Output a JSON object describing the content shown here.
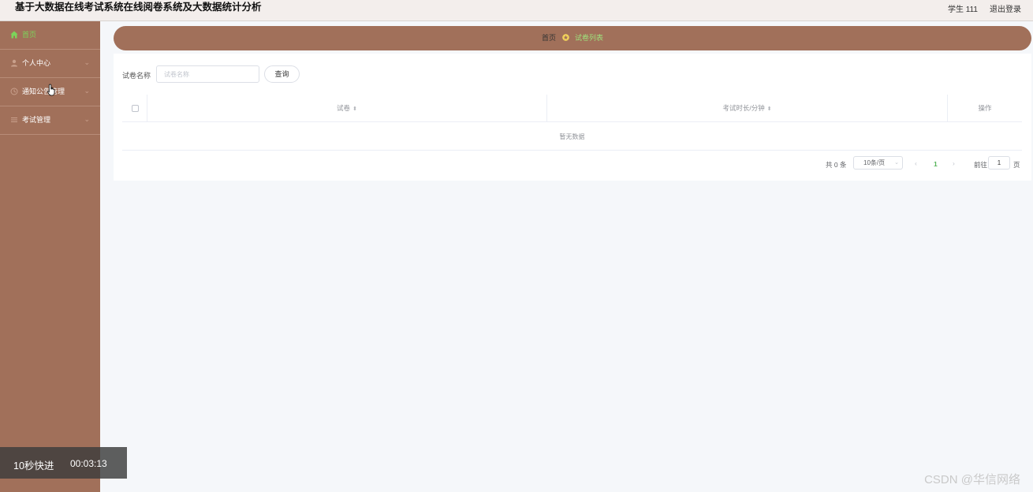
{
  "header": {
    "title": "基于大数据在线考试系统在线阅卷系统及大数据统计分析",
    "user": "学生 111",
    "logout": "退出登录"
  },
  "sidebar": {
    "items": [
      {
        "label": "首页",
        "icon": "home-icon",
        "active": true
      },
      {
        "label": "个人中心",
        "icon": "user-icon",
        "expandable": true
      },
      {
        "label": "通知公告管理",
        "icon": "clock-icon",
        "expandable": true
      },
      {
        "label": "考试管理",
        "icon": "list-icon",
        "expandable": true
      }
    ]
  },
  "breadcrumb": {
    "home": "首页",
    "current": "试卷列表"
  },
  "search": {
    "label": "试卷名称",
    "placeholder": "试卷名称",
    "button": "查询"
  },
  "table": {
    "columns": [
      "试卷",
      "考试时长/分钟",
      "操作"
    ],
    "empty_text": "暂无数据"
  },
  "pagination": {
    "total": "共 0 条",
    "page_size": "10条/页",
    "current_page": "1",
    "goto_label": "前往",
    "goto_value": "1",
    "page_suffix": "页"
  },
  "overlay": {
    "label": "10秒快进",
    "time": "00:03:13"
  },
  "watermark": "CSDN @华信网络",
  "colors": {
    "sidebar": "#a1705a",
    "active_text": "#7cd45a",
    "page_accent": "#56b45a"
  }
}
